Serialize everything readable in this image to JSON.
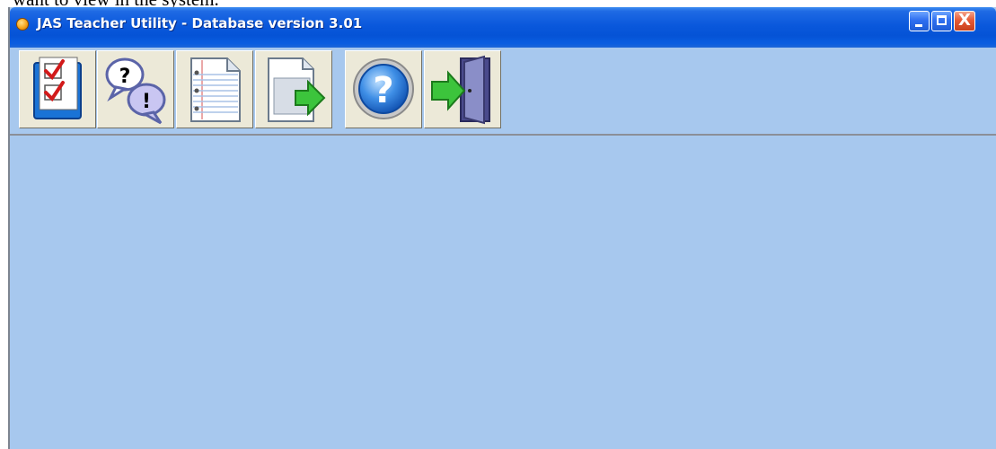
{
  "document": {
    "text_above": "want to view in the system."
  },
  "window": {
    "title": "JAS Teacher Utility - Database version 3.01",
    "controls": {
      "minimize": "minimize",
      "maximize": "maximize",
      "close": "X"
    }
  },
  "toolbar": {
    "buttons": [
      {
        "icon": "checklist-icon",
        "tooltip": ""
      },
      {
        "icon": "question-answer-icon",
        "tooltip": ""
      },
      {
        "icon": "notebook-page-icon",
        "tooltip": ""
      },
      {
        "icon": "export-document-icon",
        "tooltip": ""
      },
      {
        "icon": "help-icon",
        "tooltip": ""
      },
      {
        "icon": "exit-door-icon",
        "tooltip": ""
      }
    ]
  },
  "colors": {
    "window_background": "#a7c8ee",
    "titlebar": "#0a58dc",
    "button_face": "#ece9d8"
  }
}
